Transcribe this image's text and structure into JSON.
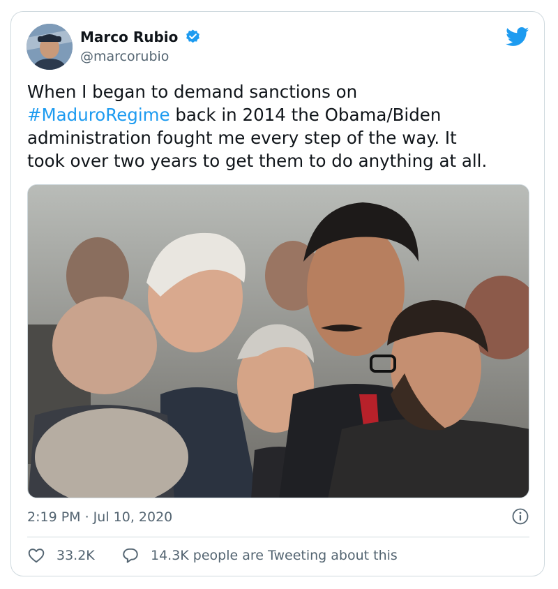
{
  "author": {
    "name": "Marco Rubio",
    "handle": "@marcorubio"
  },
  "tweet": {
    "line1": "When I began to demand sanctions on",
    "hashtag": "#MaduroRegime",
    "line2_rest": " back in 2014 the Obama/Biden",
    "line3": "administration fought me every step of the way. It",
    "line4": "took over two years to get them to do anything at all."
  },
  "meta": {
    "timestamp": "2:19 PM · Jul 10, 2020",
    "likes": "33.2K",
    "replies_text": "14.3K people are Tweeting about this"
  },
  "icons": {
    "verified": "verified-badge-icon",
    "brand": "twitter-bird-icon",
    "info": "info-icon",
    "like": "heart-icon",
    "reply": "speech-bubble-icon"
  },
  "colors": {
    "accent": "#1d9bf0",
    "text": "#0f1419",
    "muted": "#536471",
    "border": "#cfd9de"
  }
}
